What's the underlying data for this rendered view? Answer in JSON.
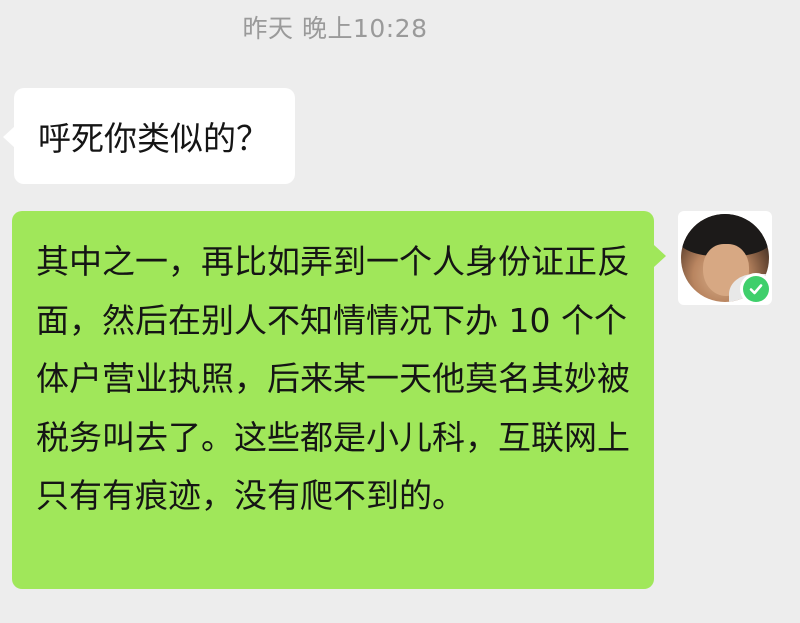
{
  "chat": {
    "timestamp": "昨天 晚上10:28",
    "messages": [
      {
        "direction": "incoming",
        "text": "呼死你类似的？"
      },
      {
        "direction": "outgoing",
        "text": "其中之一，再比如弄到一个人身份证正反面，然后在别人不知情情况下办 10 个个体户营业执照，后来某一天他莫名其妙被税务叫去了。这些都是小儿科，互联网上只有有痕迹，没有爬不到的。"
      }
    ],
    "avatar": {
      "icon": "user-avatar",
      "badge_icon": "check-badge-icon"
    }
  },
  "colors": {
    "background": "#ededed",
    "incoming_bubble": "#ffffff",
    "outgoing_bubble": "#a0e75a",
    "timestamp_text": "#9a9a9a",
    "badge": "#3fcf6b"
  }
}
